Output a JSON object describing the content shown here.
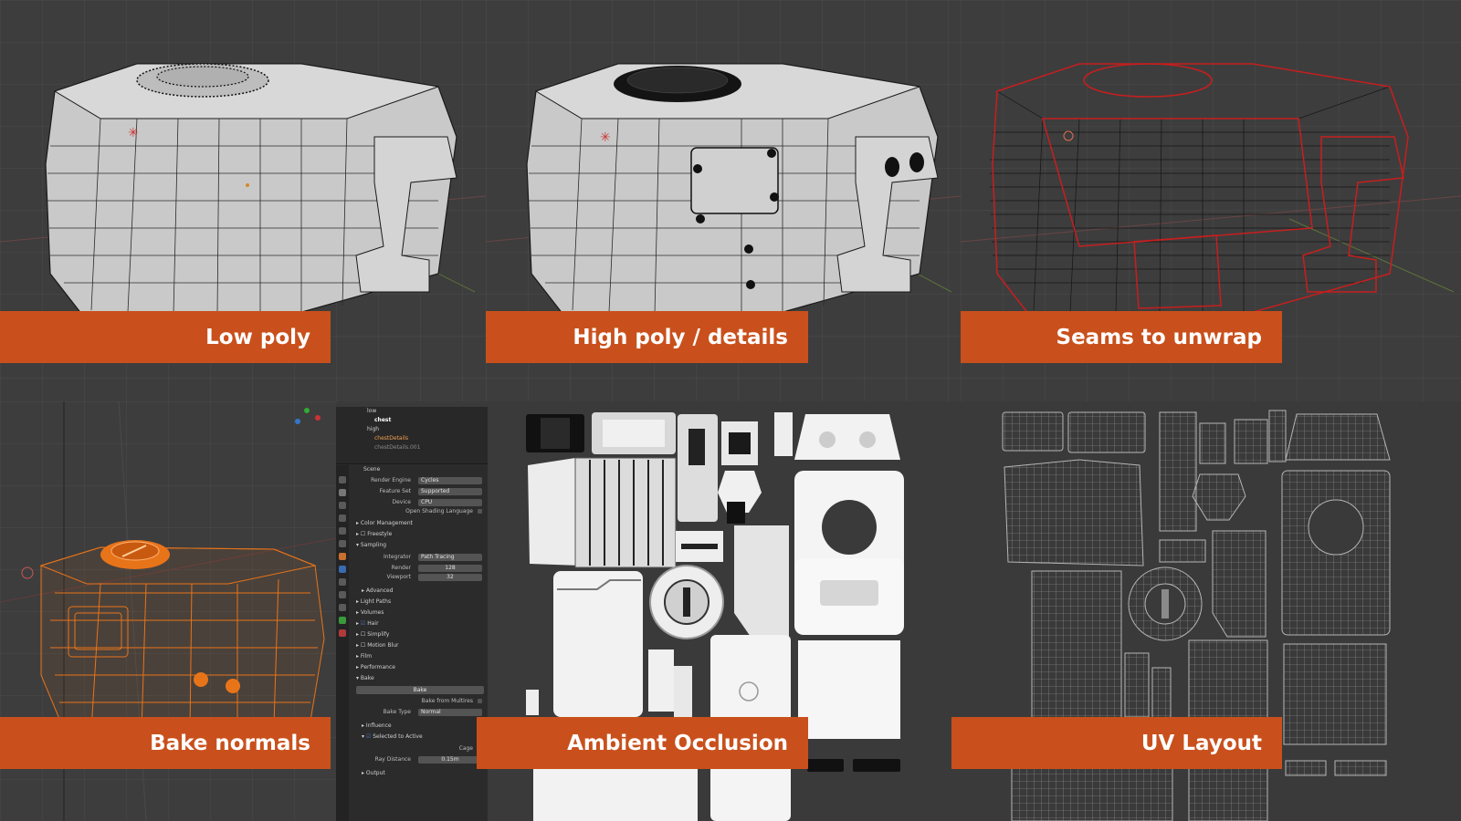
{
  "captions": {
    "low_poly": "Low poly",
    "high_poly": "High poly / details",
    "seams": "Seams to unwrap",
    "bake_normals": "Bake normals",
    "ambient_occlusion": "Ambient Occlusion",
    "uv_layout": "UV Layout"
  },
  "colors": {
    "caption_bg": "#c9501c",
    "viewport_bg": "#3d3d3d",
    "seam_red": "#c81e1e",
    "selection_orange": "#e8741a"
  },
  "outliner": {
    "items": [
      {
        "label": "low"
      },
      {
        "label": "chest"
      },
      {
        "label": "high"
      },
      {
        "label": "chestDetails"
      },
      {
        "label": "chestDetails.001"
      }
    ]
  },
  "properties": {
    "scene_label": "Scene",
    "render_engine_label": "Render Engine",
    "render_engine_value": "Cycles",
    "feature_set_label": "Feature Set",
    "feature_set_value": "Supported",
    "device_label": "Device",
    "device_value": "CPU",
    "osl_label": "Open Shading Language",
    "color_management": "Color Management",
    "freestyle": "Freestyle",
    "sampling": "Sampling",
    "integrator_label": "Integrator",
    "integrator_value": "Path Tracing",
    "render_label": "Render",
    "render_value": "128",
    "viewport_label": "Viewport",
    "viewport_value": "32",
    "advanced": "Advanced",
    "light_paths": "Light Paths",
    "volumes": "Volumes",
    "hair": "Hair",
    "simplify": "Simplify",
    "motion_blur": "Motion Blur",
    "film": "Film",
    "performance": "Performance",
    "bake": "Bake",
    "bake_button": "Bake",
    "bake_from_multires": "Bake from Multires",
    "bake_type_label": "Bake Type",
    "bake_type_value": "Normal",
    "influence": "Influence",
    "selected_to_active": "Selected to Active",
    "cage_label": "Cage",
    "ray_distance_label": "Ray Distance",
    "ray_distance_value": "0.15m",
    "output": "Output"
  }
}
